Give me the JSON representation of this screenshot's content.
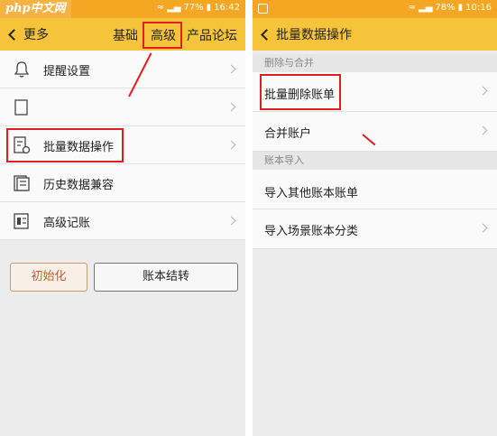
{
  "watermark": "php中文网",
  "left": {
    "status": {
      "battery": "77%",
      "time": "16:42"
    },
    "nav": {
      "back": "更多",
      "tabs": [
        "基础",
        "高级",
        "产品论坛"
      ]
    },
    "items": [
      {
        "label": "提醒设置"
      },
      {
        "label": ""
      },
      {
        "label": "批量数据操作"
      },
      {
        "label": "历史数据兼容"
      },
      {
        "label": "高级记账"
      }
    ],
    "buttons": {
      "init": "初始化",
      "close": "账本结转"
    }
  },
  "right": {
    "status": {
      "battery": "78%",
      "time": "10:16"
    },
    "nav": {
      "back": "批量数据操作"
    },
    "sections": [
      "删除与合并",
      "账本导入"
    ],
    "items": [
      {
        "label": "批量删除账单"
      },
      {
        "label": "合并账户"
      },
      {
        "label": "导入其他账本账单"
      },
      {
        "label": "导入场景账本分类"
      }
    ]
  },
  "colors": {
    "statusbar": "#f5a623",
    "navbar": "#f5c43a",
    "highlight": "#e02020"
  }
}
